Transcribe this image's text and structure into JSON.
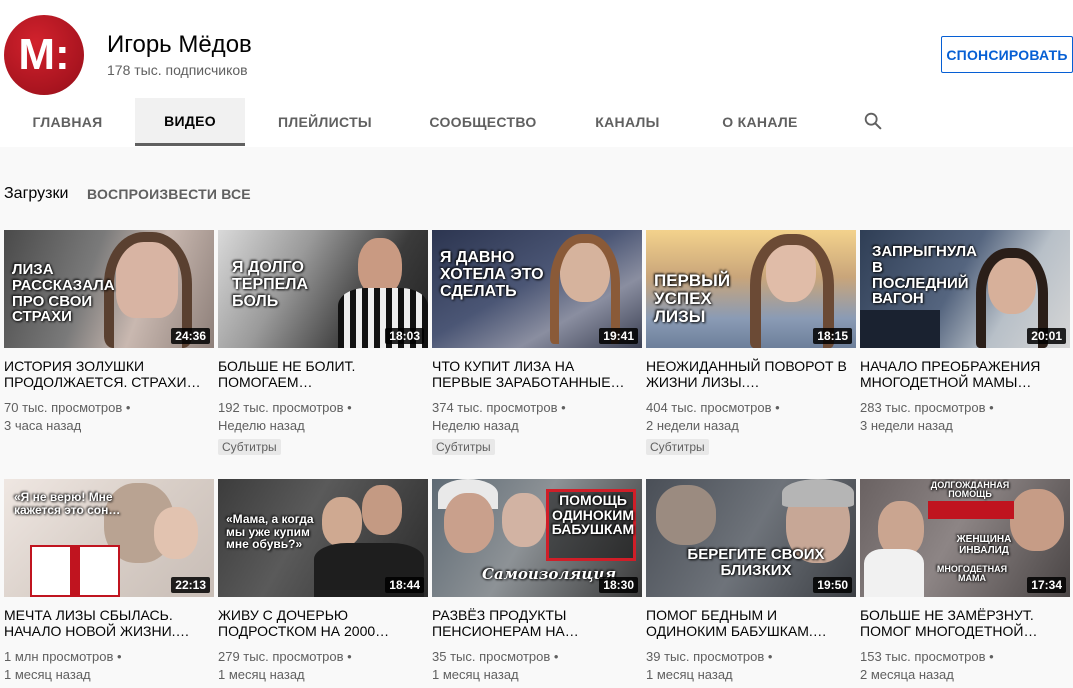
{
  "channel": {
    "avatar_letters": "M:",
    "name": "Игорь Мёдов",
    "subscribers": "178 тыс. подписчиков",
    "sponsor_label": "СПОНСИРОВАТЬ"
  },
  "tabs": [
    {
      "label": "ГЛАВНАЯ",
      "active": false
    },
    {
      "label": "ВИДЕО",
      "active": true
    },
    {
      "label": "ПЛЕЙЛИСТЫ",
      "active": false
    },
    {
      "label": "СООБЩЕСТВО",
      "active": false
    },
    {
      "label": "КАНАЛЫ",
      "active": false
    },
    {
      "label": "О КАНАЛЕ",
      "active": false
    }
  ],
  "search_icon": "search-icon",
  "section": {
    "title": "Загрузки",
    "play_all": "ВОСПРОИЗВЕСТИ ВСЕ"
  },
  "videos": [
    {
      "thumb_text": "ЛИЗА РАССКАЗАЛА ПРО СВОИ СТРАХИ",
      "duration": "24:36",
      "title": "ИСТОРИЯ ЗОЛУШКИ ПРОДОЛЖАЕТСЯ. СТРАХИ…",
      "views": "70 тыс. просмотров •",
      "date": "3 часа назад",
      "badge": ""
    },
    {
      "thumb_text": "Я ДОЛГО ТЕРПЕЛА БОЛЬ",
      "duration": "18:03",
      "title": "БОЛЬШЕ НЕ БОЛИТ. ПОМОГАЕМ…",
      "views": "192 тыс. просмотров •",
      "date": "Неделю назад",
      "badge": "Субтитры"
    },
    {
      "thumb_text": "Я ДАВНО ХОТЕЛА ЭТО СДЕЛАТЬ",
      "duration": "19:41",
      "title": "ЧТО КУПИТ ЛИЗА НА ПЕРВЫЕ ЗАРАБОТАННЫЕ…",
      "views": "374 тыс. просмотров •",
      "date": "Неделю назад",
      "badge": "Субтитры"
    },
    {
      "thumb_text": "ПЕРВЫЙ УСПЕХ ЛИЗЫ",
      "duration": "18:15",
      "title": "НЕОЖИДАННЫЙ ПОВОРОТ В ЖИЗНИ ЛИЗЫ.…",
      "views": "404 тыс. просмотров •",
      "date": "2 недели назад",
      "badge": "Субтитры"
    },
    {
      "thumb_text": "ЗАПРЫГНУЛА В ПОСЛЕДНИЙ ВАГОН",
      "duration": "20:01",
      "title": "НАЧАЛО ПРЕОБРАЖЕНИЯ МНОГОДЕТНОЙ МАМЫ…",
      "views": "283 тыс. просмотров •",
      "date": "3 недели назад",
      "badge": ""
    },
    {
      "thumb_text": "«Я не верю! Мне кажется это сон…",
      "duration": "22:13",
      "title": "МЕЧТА ЛИЗЫ СБЫЛАСЬ. НАЧАЛО НОВОЙ ЖИЗНИ.…",
      "views": "1 млн просмотров •",
      "date": "1 месяц назад",
      "badge": ""
    },
    {
      "thumb_text": "«Мама, а когда мы уже купим мне обувь?»",
      "duration": "18:44",
      "title": "ЖИВУ С ДОЧЕРЬЮ ПОДРОСТКОМ НА 2000…",
      "views": "279 тыс. просмотров •",
      "date": "1 месяц назад",
      "badge": ""
    },
    {
      "thumb_text": "ПОМОЩЬ ОДИНОКИМ БАБУШКАМ",
      "thumb_text2": "Самоизоляция",
      "duration": "18:30",
      "title": "РАЗВЁЗ ПРОДУКТЫ ПЕНСИОНЕРАМ НА…",
      "views": "35 тыс. просмотров •",
      "date": "1 месяц назад",
      "badge": ""
    },
    {
      "thumb_text": "БЕРЕГИТЕ СВОИХ БЛИЗКИХ",
      "duration": "19:50",
      "title": "ПОМОГ БЕДНЫМ И ОДИНОКИМ БАБУШКАМ.…",
      "views": "39 тыс. просмотров •",
      "date": "1 месяц назад",
      "badge": ""
    },
    {
      "thumb_text": "ДОЛГОЖДАННАЯ ПОМОЩЬ",
      "thumb_text2": "ЖЕНЩИНА ИНВАЛИД",
      "thumb_text3": "МНОГОДЕТНАЯ МАМА",
      "duration": "17:34",
      "title": "БОЛЬШЕ НЕ ЗАМЁРЗНУТ. ПОМОГ МНОГОДЕТНОЙ…",
      "views": "153 тыс. просмотров •",
      "date": "2 месяца назад",
      "badge": ""
    }
  ]
}
